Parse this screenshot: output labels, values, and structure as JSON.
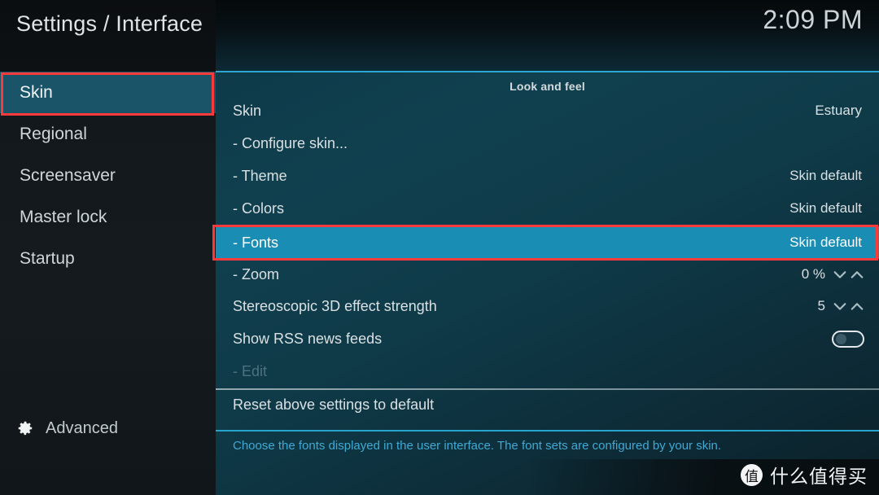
{
  "header": {
    "title": "Settings / Interface",
    "clock": "2:09 PM"
  },
  "sidebar": {
    "items": [
      {
        "label": "Skin",
        "selected": true
      },
      {
        "label": "Regional",
        "selected": false
      },
      {
        "label": "Screensaver",
        "selected": false
      },
      {
        "label": "Master lock",
        "selected": false
      },
      {
        "label": "Startup",
        "selected": false
      }
    ],
    "advanced": {
      "label": "Advanced",
      "icon": "gear-icon"
    }
  },
  "content": {
    "section_title": "Look and feel",
    "rows": [
      {
        "label": "Skin",
        "value": "Estuary",
        "type": "value"
      },
      {
        "label": "- Configure skin...",
        "value": "",
        "type": "action"
      },
      {
        "label": "- Theme",
        "value": "Skin default",
        "type": "value"
      },
      {
        "label": "- Colors",
        "value": "Skin default",
        "type": "value"
      },
      {
        "label": "- Fonts",
        "value": "Skin default",
        "type": "value",
        "selected": true
      },
      {
        "label": "- Zoom",
        "value": "0 %",
        "type": "spinner"
      },
      {
        "label": "Stereoscopic 3D effect strength",
        "value": "5",
        "type": "spinner"
      },
      {
        "label": "Show RSS news feeds",
        "value": "",
        "type": "toggle",
        "toggle_on": false
      },
      {
        "label": "- Edit",
        "value": "",
        "type": "action",
        "disabled": true
      },
      {
        "label": "Reset above settings to default",
        "value": "",
        "type": "action"
      }
    ],
    "help_text": "Choose the fonts displayed in the user interface. The font sets are configured by your skin."
  },
  "watermark": {
    "badge": "值",
    "text": "什么值得买"
  },
  "colors": {
    "selection_highlight": "#1a8db5",
    "sidebar_selection": "#1a5468",
    "annotation_border": "#fb3b3b",
    "accent_cyan": "#27a4cc",
    "help_text": "#3fa9d4"
  }
}
